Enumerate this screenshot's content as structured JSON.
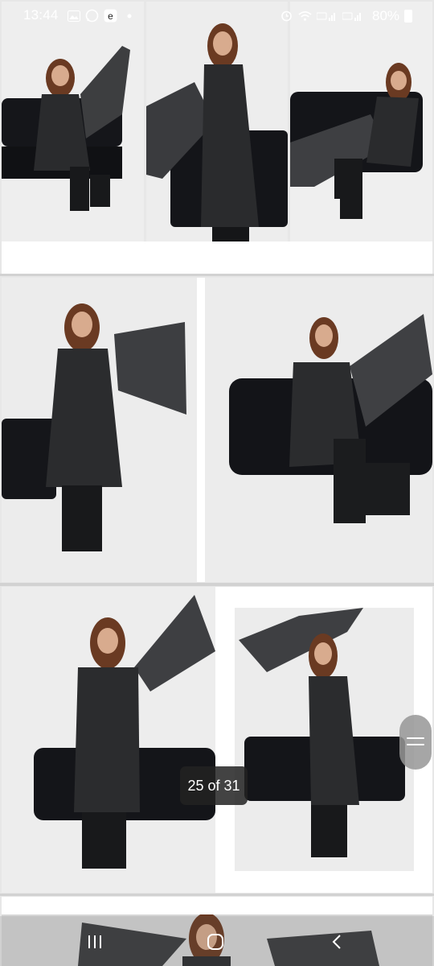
{
  "status_bar": {
    "time": "13:44",
    "left_icons": [
      "gallery-icon",
      "whatsapp-icon",
      "app-icon",
      "dot-icon"
    ],
    "right_icons": [
      "alarm-icon",
      "wifi-icon",
      "signal-volte-1-icon",
      "signal-volte-2-icon"
    ],
    "battery": "80%"
  },
  "gallery": {
    "counter": "25 of 31",
    "photos": [
      "product-photo-seated-sofa-dupatta-raised",
      "product-photo-standing-holding-dupatta",
      "product-photo-reclining-sofa",
      "product-photo-standing-dupatta-spread",
      "product-photo-seated-sofa-side",
      "product-photo-standing-arms-crossed",
      "product-photo-standing-side-pose",
      "product-photo-partial-bottom"
    ]
  },
  "colors": {
    "background": "#e7e7e7",
    "outfit": "#1f2022",
    "sofa": "#121315",
    "skin": "#d8ab8e",
    "hair": "#6a3a22"
  },
  "nav_bar": {
    "buttons": [
      "recent-apps-icon",
      "home-icon",
      "back-icon"
    ]
  }
}
